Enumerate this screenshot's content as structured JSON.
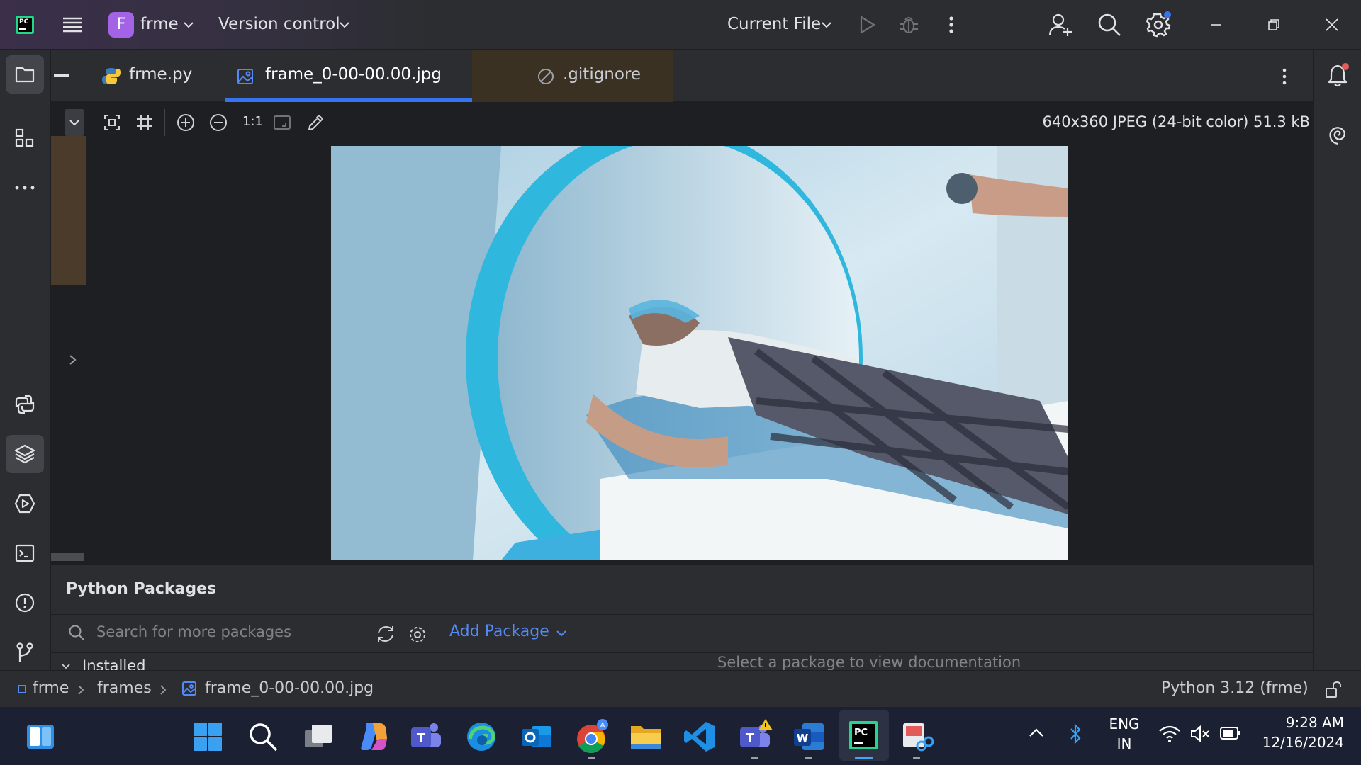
{
  "titlebar": {
    "project_letter": "F",
    "project_name": "frme",
    "vcs_label": "Version control",
    "run_config": "Current File"
  },
  "tabs": [
    {
      "label": "frme.py",
      "icon": "python-file-icon",
      "active": false
    },
    {
      "label": "frame_0-00-00.00.jpg",
      "icon": "image-file-icon",
      "active": true
    },
    {
      "label": ".gitignore",
      "icon": "ignore-file-icon",
      "active": false
    }
  ],
  "image_toolbar": {
    "actual_size": "1:1",
    "image_info": "640x360 JPEG (24-bit color) 51.3 kB"
  },
  "packages": {
    "title": "Python Packages",
    "search_placeholder": "Search for more packages",
    "add_package": "Add Package",
    "installed_label": "Installed",
    "doc_placeholder": "Select a package to view documentation"
  },
  "breadcrumb": [
    "frme",
    "frames",
    "frame_0-00-00.00.jpg"
  ],
  "status": {
    "interpreter": "Python 3.12 (frme)"
  },
  "tray": {
    "lang_top": "ENG",
    "lang_bottom": "IN",
    "time": "9:28 AM",
    "date": "12/16/2024"
  },
  "colors": {
    "accent": "#3574f0",
    "project_badge": "#a463e6",
    "taskbar": "#1b2132"
  }
}
